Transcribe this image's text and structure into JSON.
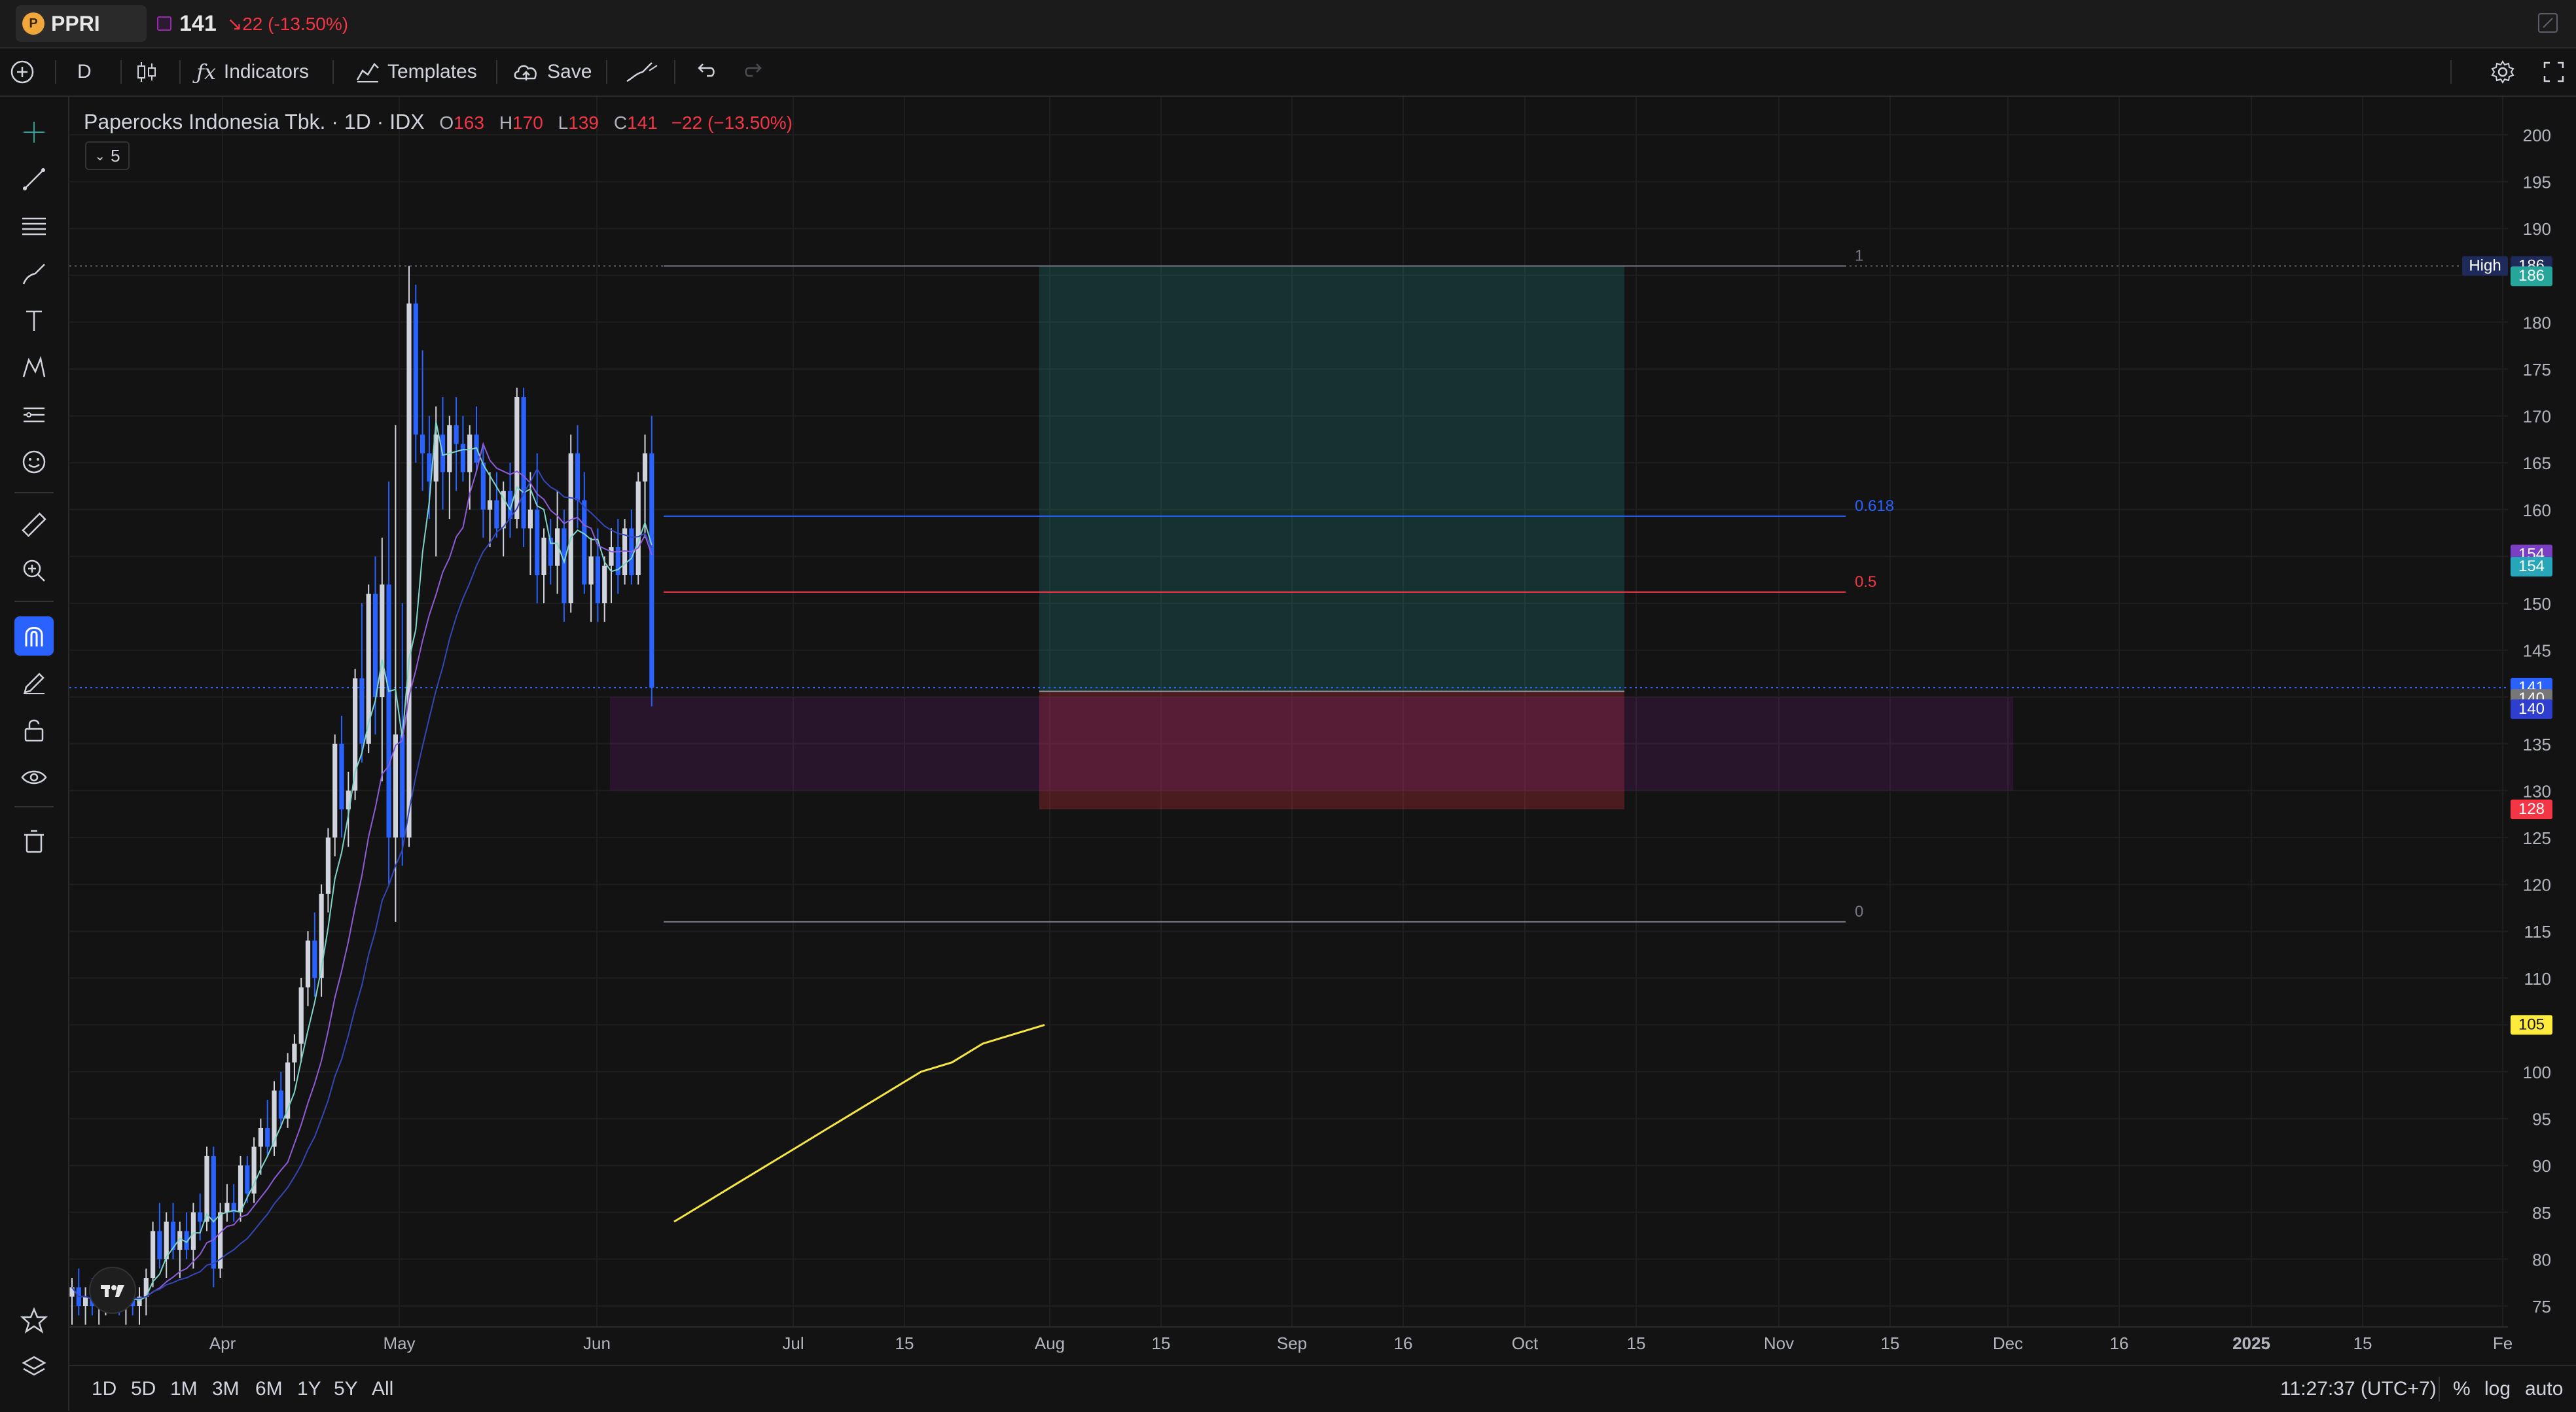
{
  "header": {
    "symbol": "PPRI",
    "price": "141",
    "change": "↘22 (-13.50%)"
  },
  "toolbar": {
    "interval": "D",
    "indicators_label": "Indicators",
    "templates_label": "Templates",
    "save_label": "Save"
  },
  "legend": {
    "title": "Paperocks Indonesia Tbk. · 1D · IDX",
    "open_label": "O",
    "open": "163",
    "high_label": "H",
    "high": "170",
    "low_label": "L",
    "low": "139",
    "close_label": "C",
    "close": "141",
    "change": "−22 (−13.50%)",
    "collapsed_count": "5"
  },
  "price_axis": {
    "ticks": [
      "200",
      "195",
      "190",
      "185",
      "180",
      "175",
      "170",
      "165",
      "160",
      "155",
      "150",
      "145",
      "140",
      "135",
      "130",
      "125",
      "120",
      "115",
      "110",
      "105",
      "100",
      "95",
      "90",
      "85",
      "80",
      "75"
    ],
    "labels": [
      {
        "text": "High",
        "value": 186,
        "color": "#1e2a5a"
      },
      {
        "text": "186",
        "value": 186,
        "color": "#1e2a5a"
      },
      {
        "text": "186",
        "value": 184.9,
        "color": "#26a69a"
      },
      {
        "text": "154",
        "value": 155.2,
        "color": "#7b3fc4"
      },
      {
        "text": "154",
        "value": 153.9,
        "color": "#26a6b8"
      },
      {
        "text": "141",
        "value": 141,
        "color": "#2962ff"
      },
      {
        "text": "140",
        "value": 139.8,
        "color": "#777777"
      },
      {
        "text": "140",
        "value": 138.7,
        "color": "#2e3ecf"
      },
      {
        "text": "128",
        "value": 128,
        "color": "#f23645"
      },
      {
        "text": "105",
        "value": 105,
        "color": "#ffeb3b"
      }
    ]
  },
  "time_axis": {
    "ticks": [
      "Apr",
      "May",
      "Jun",
      "Jul",
      "15",
      "Aug",
      "15",
      "Sep",
      "16",
      "Oct",
      "15",
      "Nov",
      "15",
      "Dec",
      "16",
      "2025",
      "15",
      "Fe"
    ]
  },
  "fib": {
    "level_1": "1",
    "level_0618": "0.618",
    "level_05": "0.5",
    "level_0": "0"
  },
  "ranges": [
    "1D",
    "5D",
    "1M",
    "3M",
    "6M",
    "1Y",
    "5Y",
    "All"
  ],
  "status": {
    "clock": "11:27:37 (UTC+7)",
    "percent": "%",
    "log": "log",
    "auto": "auto"
  },
  "chart_data": {
    "type": "candlestick",
    "price_range": [
      73,
      205
    ],
    "candles": [
      {
        "o": 76,
        "h": 78,
        "l": 73,
        "c": 77
      },
      {
        "o": 77,
        "h": 79,
        "l": 74,
        "c": 75
      },
      {
        "o": 75,
        "h": 77,
        "l": 73,
        "c": 76
      },
      {
        "o": 76,
        "h": 78,
        "l": 74,
        "c": 75
      },
      {
        "o": 75,
        "h": 77,
        "l": 73,
        "c": 76
      },
      {
        "o": 76,
        "h": 78,
        "l": 74,
        "c": 77
      },
      {
        "o": 77,
        "h": 79,
        "l": 75,
        "c": 76
      },
      {
        "o": 76,
        "h": 78,
        "l": 74,
        "c": 75
      },
      {
        "o": 75,
        "h": 77,
        "l": 73,
        "c": 76
      },
      {
        "o": 76,
        "h": 77,
        "l": 74,
        "c": 75
      },
      {
        "o": 75,
        "h": 77,
        "l": 73,
        "c": 76
      },
      {
        "o": 76,
        "h": 79,
        "l": 74,
        "c": 78
      },
      {
        "o": 78,
        "h": 84,
        "l": 77,
        "c": 83
      },
      {
        "o": 83,
        "h": 86,
        "l": 79,
        "c": 80
      },
      {
        "o": 80,
        "h": 85,
        "l": 78,
        "c": 84
      },
      {
        "o": 84,
        "h": 86,
        "l": 80,
        "c": 81
      },
      {
        "o": 81,
        "h": 84,
        "l": 78,
        "c": 83
      },
      {
        "o": 83,
        "h": 85,
        "l": 80,
        "c": 81
      },
      {
        "o": 81,
        "h": 86,
        "l": 79,
        "c": 85
      },
      {
        "o": 85,
        "h": 87,
        "l": 82,
        "c": 84
      },
      {
        "o": 84,
        "h": 92,
        "l": 83,
        "c": 91
      },
      {
        "o": 91,
        "h": 92,
        "l": 77,
        "c": 79
      },
      {
        "o": 79,
        "h": 86,
        "l": 78,
        "c": 85
      },
      {
        "o": 85,
        "h": 88,
        "l": 84,
        "c": 86
      },
      {
        "o": 86,
        "h": 88,
        "l": 84,
        "c": 85
      },
      {
        "o": 85,
        "h": 91,
        "l": 84,
        "c": 90
      },
      {
        "o": 90,
        "h": 91,
        "l": 86,
        "c": 87
      },
      {
        "o": 87,
        "h": 93,
        "l": 86,
        "c": 92
      },
      {
        "o": 92,
        "h": 95,
        "l": 89,
        "c": 94
      },
      {
        "o": 94,
        "h": 97,
        "l": 91,
        "c": 92
      },
      {
        "o": 92,
        "h": 99,
        "l": 91,
        "c": 98
      },
      {
        "o": 98,
        "h": 100,
        "l": 94,
        "c": 95
      },
      {
        "o": 95,
        "h": 102,
        "l": 94,
        "c": 101
      },
      {
        "o": 101,
        "h": 104,
        "l": 99,
        "c": 103
      },
      {
        "o": 103,
        "h": 110,
        "l": 101,
        "c": 109
      },
      {
        "o": 109,
        "h": 115,
        "l": 107,
        "c": 114
      },
      {
        "o": 114,
        "h": 117,
        "l": 108,
        "c": 110
      },
      {
        "o": 110,
        "h": 120,
        "l": 108,
        "c": 119
      },
      {
        "o": 119,
        "h": 126,
        "l": 117,
        "c": 125
      },
      {
        "o": 125,
        "h": 136,
        "l": 123,
        "c": 135
      },
      {
        "o": 135,
        "h": 138,
        "l": 125,
        "c": 128
      },
      {
        "o": 128,
        "h": 132,
        "l": 124,
        "c": 130
      },
      {
        "o": 130,
        "h": 143,
        "l": 129,
        "c": 142
      },
      {
        "o": 142,
        "h": 150,
        "l": 133,
        "c": 135
      },
      {
        "o": 135,
        "h": 152,
        "l": 134,
        "c": 151
      },
      {
        "o": 151,
        "h": 155,
        "l": 136,
        "c": 140
      },
      {
        "o": 140,
        "h": 157,
        "l": 131,
        "c": 152
      },
      {
        "o": 152,
        "h": 163,
        "l": 120,
        "c": 125
      },
      {
        "o": 125,
        "h": 169,
        "l": 116,
        "c": 136
      },
      {
        "o": 136,
        "h": 150,
        "l": 122,
        "c": 125
      },
      {
        "o": 125,
        "h": 186,
        "l": 124,
        "c": 182
      },
      {
        "o": 182,
        "h": 184,
        "l": 165,
        "c": 168
      },
      {
        "o": 168,
        "h": 177,
        "l": 162,
        "c": 166
      },
      {
        "o": 166,
        "h": 170,
        "l": 159,
        "c": 163
      },
      {
        "o": 163,
        "h": 171,
        "l": 155,
        "c": 168
      },
      {
        "o": 168,
        "h": 172,
        "l": 160,
        "c": 164
      },
      {
        "o": 164,
        "h": 170,
        "l": 159,
        "c": 169
      },
      {
        "o": 169,
        "h": 172,
        "l": 162,
        "c": 167
      },
      {
        "o": 167,
        "h": 170,
        "l": 163,
        "c": 164
      },
      {
        "o": 164,
        "h": 169,
        "l": 160,
        "c": 168
      },
      {
        "o": 168,
        "h": 171,
        "l": 164,
        "c": 165
      },
      {
        "o": 165,
        "h": 167,
        "l": 157,
        "c": 160
      },
      {
        "o": 160,
        "h": 164,
        "l": 156,
        "c": 161
      },
      {
        "o": 161,
        "h": 164,
        "l": 157,
        "c": 158
      },
      {
        "o": 158,
        "h": 163,
        "l": 155,
        "c": 162
      },
      {
        "o": 162,
        "h": 165,
        "l": 157,
        "c": 159
      },
      {
        "o": 159,
        "h": 173,
        "l": 158,
        "c": 172
      },
      {
        "o": 172,
        "h": 173,
        "l": 156,
        "c": 158
      },
      {
        "o": 158,
        "h": 164,
        "l": 153,
        "c": 160
      },
      {
        "o": 160,
        "h": 166,
        "l": 150,
        "c": 153
      },
      {
        "o": 153,
        "h": 158,
        "l": 150,
        "c": 157
      },
      {
        "o": 157,
        "h": 159,
        "l": 152,
        "c": 154
      },
      {
        "o": 154,
        "h": 162,
        "l": 151,
        "c": 158
      },
      {
        "o": 158,
        "h": 160,
        "l": 148,
        "c": 150
      },
      {
        "o": 150,
        "h": 168,
        "l": 149,
        "c": 166
      },
      {
        "o": 166,
        "h": 169,
        "l": 158,
        "c": 161
      },
      {
        "o": 161,
        "h": 164,
        "l": 151,
        "c": 152
      },
      {
        "o": 152,
        "h": 157,
        "l": 148,
        "c": 155
      },
      {
        "o": 155,
        "h": 158,
        "l": 148,
        "c": 150
      },
      {
        "o": 150,
        "h": 155,
        "l": 148,
        "c": 154
      },
      {
        "o": 154,
        "h": 158,
        "l": 150,
        "c": 156
      },
      {
        "o": 156,
        "h": 159,
        "l": 151,
        "c": 153
      },
      {
        "o": 153,
        "h": 159,
        "l": 152,
        "c": 158
      },
      {
        "o": 158,
        "h": 160,
        "l": 152,
        "c": 153
      },
      {
        "o": 153,
        "h": 164,
        "l": 152,
        "c": 163
      },
      {
        "o": 163,
        "h": 168,
        "l": 157,
        "c": 166
      },
      {
        "o": 166,
        "h": 170,
        "l": 139,
        "c": 141
      }
    ],
    "series": [
      {
        "name": "",
        "color": "#7fd4c8",
        "note": "short MA"
      },
      {
        "name": "",
        "color": "#8e5cd9",
        "note": "mid MA"
      },
      {
        "name": "",
        "color": "#3447b8",
        "note": "long MA"
      },
      {
        "name": "",
        "color": "#f5e642",
        "note": "yellow MA",
        "values": [
          84,
          86,
          88,
          90,
          92,
          94,
          96,
          98,
          100,
          101,
          103,
          104,
          105
        ]
      }
    ],
    "fib_levels": [
      {
        "ratio": "1",
        "price": 186
      },
      {
        "ratio": "0.618",
        "price": 159.3
      },
      {
        "ratio": "0.5",
        "price": 151.2
      },
      {
        "ratio": "0",
        "price": 116
      }
    ],
    "position": {
      "entry": 140.6,
      "target": 186,
      "stop": 128
    }
  }
}
